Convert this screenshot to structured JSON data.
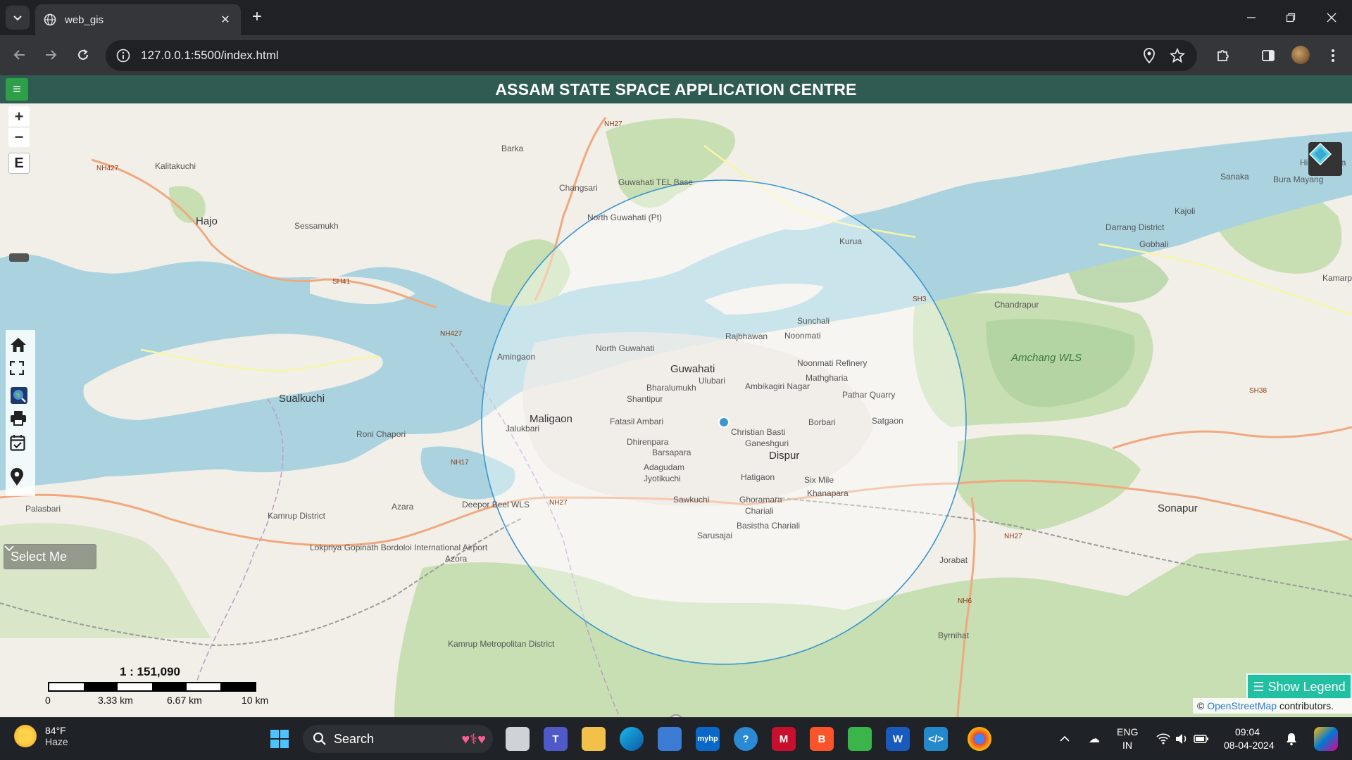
{
  "browser": {
    "tab_title": "web_gis",
    "url": "127.0.0.1:5500/index.html"
  },
  "header": {
    "title": "ASSAM STATE SPACE APPLICATION CENTRE",
    "menu_icon": "≡"
  },
  "map": {
    "zoom_in": "+",
    "zoom_out": "−",
    "edit_label": "E",
    "select_label": "Select Me",
    "scale_ratio": "1 : 151,090",
    "scale_labels": [
      "0",
      "3.33 km",
      "6.67 km",
      "10 km"
    ],
    "legend_button": "☰ Show Legend",
    "attribution_prefix": "©",
    "attribution_link": "OpenStreetMap",
    "attribution_suffix": "contributors.",
    "place_labels": [
      {
        "text": "Barka"
      },
      {
        "text": "NH27"
      },
      {
        "text": "Kalitakuchi"
      },
      {
        "text": "NH427"
      },
      {
        "text": "Changsari"
      },
      {
        "text": "Guwahati TEL Base"
      },
      {
        "text": "North Guwahati (Pt)"
      },
      {
        "text": "Hajo"
      },
      {
        "text": "Sessamukh"
      },
      {
        "text": "SH41"
      },
      {
        "text": "NH427"
      },
      {
        "text": "Kurua"
      },
      {
        "text": "Sunchali"
      },
      {
        "text": "Noonmati"
      },
      {
        "text": "Rajbhawan"
      },
      {
        "text": "North Guwahati"
      },
      {
        "text": "Amingaon"
      },
      {
        "text": "Noonmati Refinery"
      },
      {
        "text": "Guwahati"
      },
      {
        "text": "Ulubari"
      },
      {
        "text": "Mathgharia"
      },
      {
        "text": "Bharalumukh"
      },
      {
        "text": "Ambikagiri Nagar"
      },
      {
        "text": "Pathar Quarry"
      },
      {
        "text": "Shantipur"
      },
      {
        "text": "Sualkuchi"
      },
      {
        "text": "Maligaon"
      },
      {
        "text": "Fatasil Ambari"
      },
      {
        "text": "Borbari"
      },
      {
        "text": "Satgaon"
      },
      {
        "text": "Roni Chapori"
      },
      {
        "text": "Jalukbari"
      },
      {
        "text": "Christian Basti"
      },
      {
        "text": "Ganeshguri"
      },
      {
        "text": "Dhirenpara"
      },
      {
        "text": "Barsapara"
      },
      {
        "text": "Dispur"
      },
      {
        "text": "NH17"
      },
      {
        "text": "Adagudam"
      },
      {
        "text": "Jyotikuchi"
      },
      {
        "text": "Hatigaon"
      },
      {
        "text": "Six Mile"
      },
      {
        "text": "Khanapara"
      },
      {
        "text": "Azara"
      },
      {
        "text": "Deepor Beel WLS"
      },
      {
        "text": "NH27"
      },
      {
        "text": "Sawkuchi"
      },
      {
        "text": "Ghoramara"
      },
      {
        "text": "Chariali"
      },
      {
        "text": "Basistha Chariali"
      },
      {
        "text": "Sarusajai"
      },
      {
        "text": "Palasbari"
      },
      {
        "text": "Lokpriya Gopinath Bordoloi International Airport"
      },
      {
        "text": "Azora"
      },
      {
        "text": "Amchang WLS"
      },
      {
        "text": "Chandrapur"
      },
      {
        "text": "Jorabat"
      },
      {
        "text": "NH27"
      },
      {
        "text": "Sonapur"
      },
      {
        "text": "NH6"
      },
      {
        "text": "Byrnihat"
      },
      {
        "text": "Kamrup Metropolitan District"
      },
      {
        "text": "SH3"
      },
      {
        "text": "SH38"
      },
      {
        "text": "Hilloikhunda"
      },
      {
        "text": "Sanaka"
      },
      {
        "text": "Bura Mayang"
      },
      {
        "text": "Kajoli"
      },
      {
        "text": "Gobhali"
      },
      {
        "text": "Kamarpur"
      },
      {
        "text": "Kamrup District"
      },
      {
        "text": "Darrang District"
      }
    ]
  },
  "taskbar": {
    "temp": "84°F",
    "condition": "Haze",
    "search_label": "Search",
    "lang_top": "ENG",
    "lang_bottom": "IN",
    "time": "09:04",
    "date": "08-04-2024"
  },
  "colors": {
    "header_bg": "#2f5b52",
    "menu_btn": "#2e9e4a",
    "legend_btn": "#22c0a2",
    "water": "#aad3df",
    "forest": "#add19e",
    "buffer": "#2f8fd0"
  }
}
